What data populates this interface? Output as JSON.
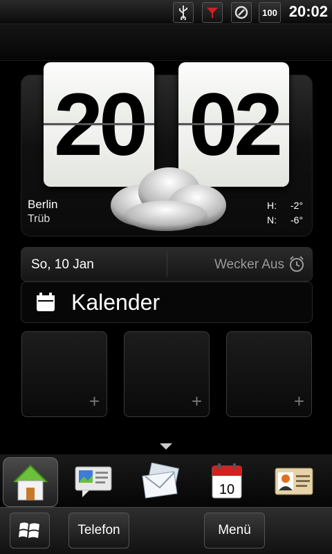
{
  "status_bar": {
    "time": "20:02",
    "battery_label": "100",
    "icons": [
      "usb-icon",
      "signal-filter-icon",
      "sync-icon",
      "battery-icon"
    ]
  },
  "clock": {
    "hours": "20",
    "minutes": "02"
  },
  "weather": {
    "city": "Berlin",
    "condition": "Trüb",
    "high_label": "H:",
    "high_value": "-2°",
    "low_label": "N:",
    "low_value": "-6°",
    "icon": "cloud-icon"
  },
  "date_row": {
    "date": "So, 10 Jan",
    "alarm": "Wecker Aus"
  },
  "calendar_widget": {
    "label": "Kalender"
  },
  "shortcut_slots": [
    {
      "plus": "+"
    },
    {
      "plus": "+"
    },
    {
      "plus": "+"
    }
  ],
  "dock": {
    "items": [
      "home-icon",
      "messages-icon",
      "mail-icon",
      "calendar-icon",
      "contacts-icon"
    ],
    "calendar_day": "10",
    "active": "home-icon"
  },
  "bottom_bar": {
    "phone_label": "Telefon",
    "menu_label": "Menü"
  },
  "colors": {
    "accent_green": "#6cc03a",
    "alarm_gray": "#9a9a9a"
  }
}
